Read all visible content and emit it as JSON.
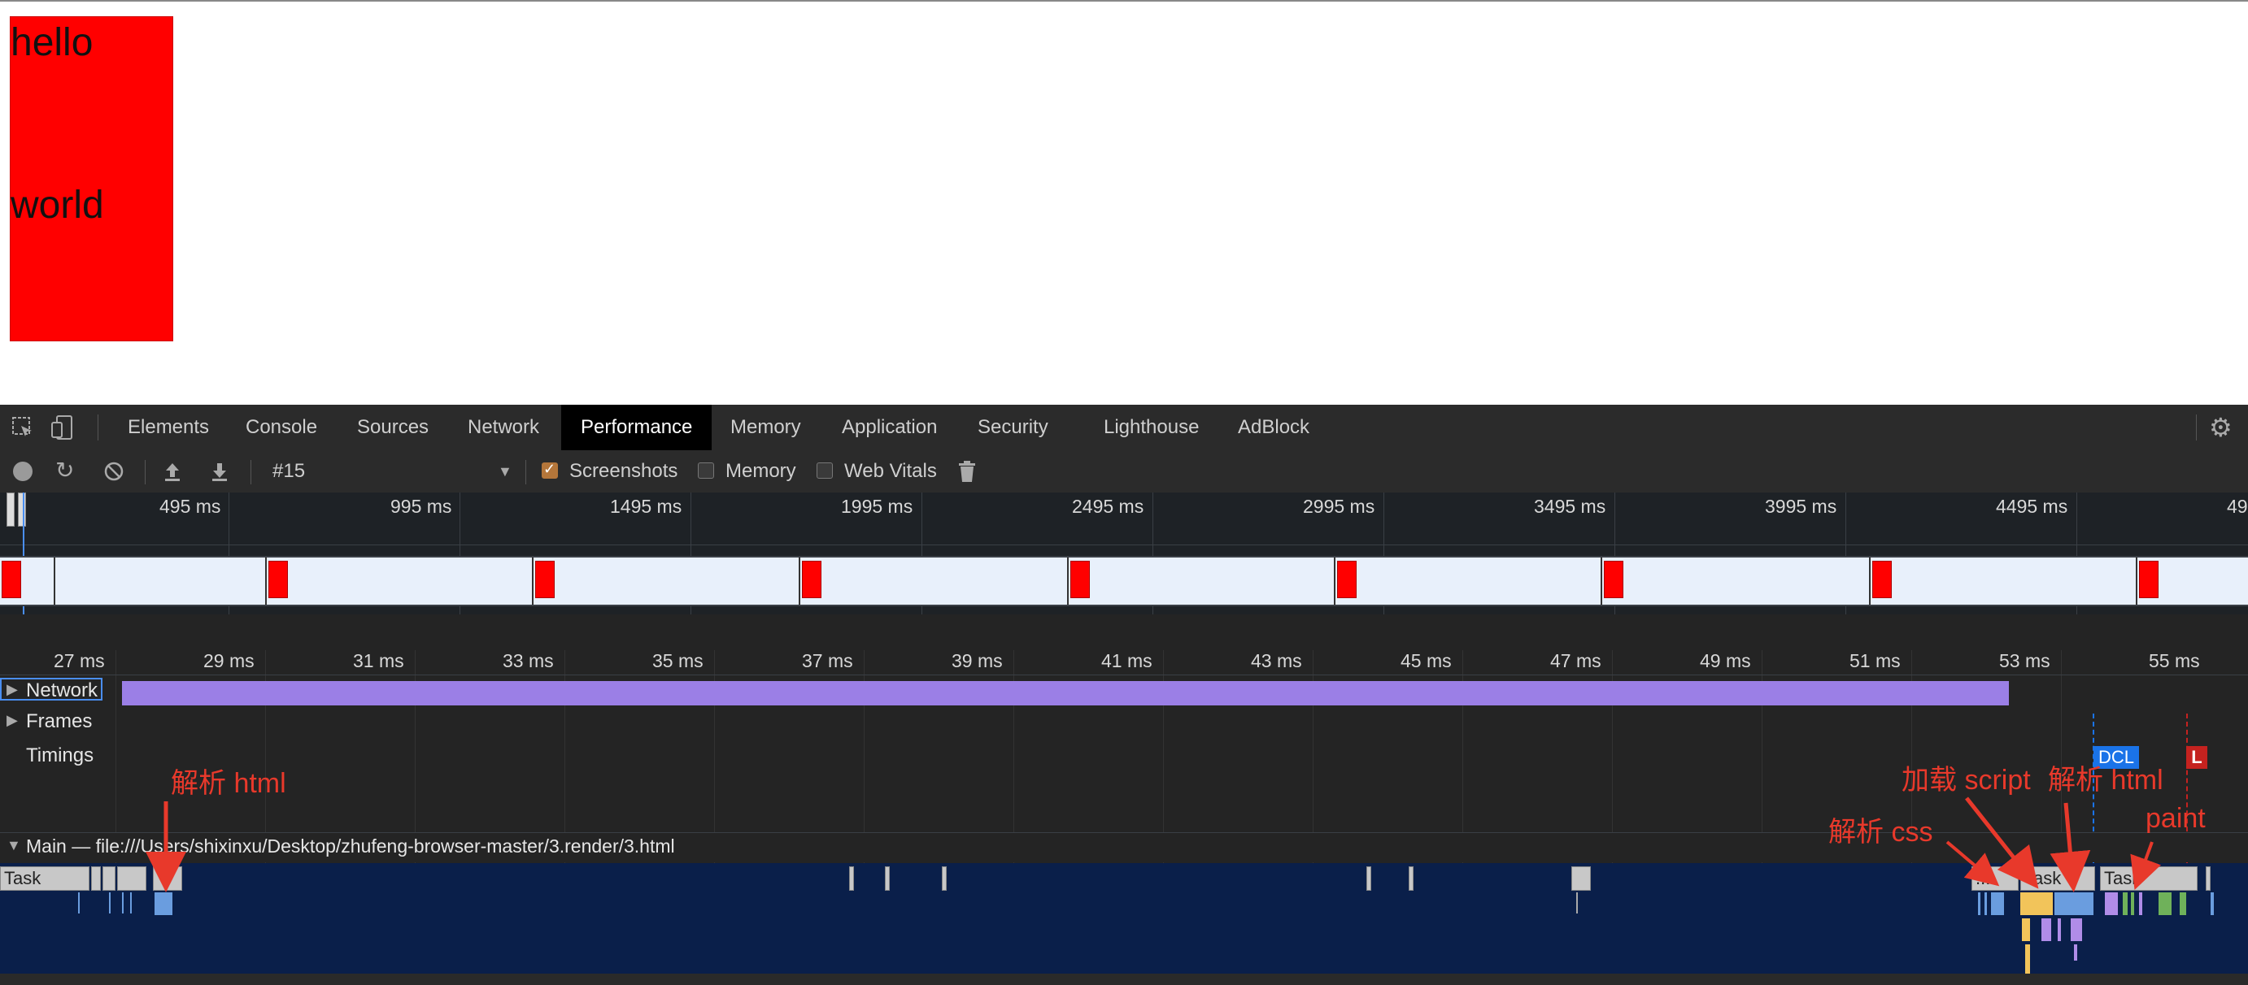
{
  "page": {
    "line1": "hello",
    "line2": "world"
  },
  "devtools": {
    "tabs": [
      "Elements",
      "Console",
      "Sources",
      "Network",
      "Performance",
      "Memory",
      "Application",
      "Security",
      "Lighthouse",
      "AdBlock"
    ],
    "active_tab": "Performance",
    "toolbar": {
      "recording_select": "#15",
      "screenshots_label": "Screenshots",
      "memory_label": "Memory",
      "web_vitals_label": "Web Vitals"
    },
    "overview_ticks": [
      "495 ms",
      "995 ms",
      "1495 ms",
      "1995 ms",
      "2495 ms",
      "2995 ms",
      "3495 ms",
      "3995 ms",
      "4495 ms",
      "49"
    ],
    "ruler_ticks": [
      "27 ms",
      "29 ms",
      "31 ms",
      "33 ms",
      "35 ms",
      "37 ms",
      "39 ms",
      "41 ms",
      "43 ms",
      "45 ms",
      "47 ms",
      "49 ms",
      "51 ms",
      "53 ms",
      "55 ms"
    ],
    "tracks": {
      "network": "Network",
      "frames": "Frames",
      "timings": "Timings"
    },
    "markers": {
      "dcl": "DCL",
      "l": "L"
    },
    "main_thread_label": "Main — file:///Users/shixinxu/Desktop/zhufeng-browser-master/3.render/3.html",
    "task_labels": {
      "task": "Task",
      "ellipsis": "..."
    },
    "annotations": {
      "parse_html_1": "解析 html",
      "load_script": "加载 script",
      "parse_html_2": "解析 html",
      "parse_css": "解析 css",
      "paint": "paint"
    },
    "colors": {
      "red_box": "#ff0000",
      "network_bar": "#9b7fe6",
      "annotation": "#e8392b",
      "dcl": "#1a73e8",
      "load": "#c5221f",
      "scripting": "#f2c45a",
      "parsing": "#6a9ddf",
      "rendering": "#b08ce8",
      "painting": "#6fb15a"
    }
  }
}
